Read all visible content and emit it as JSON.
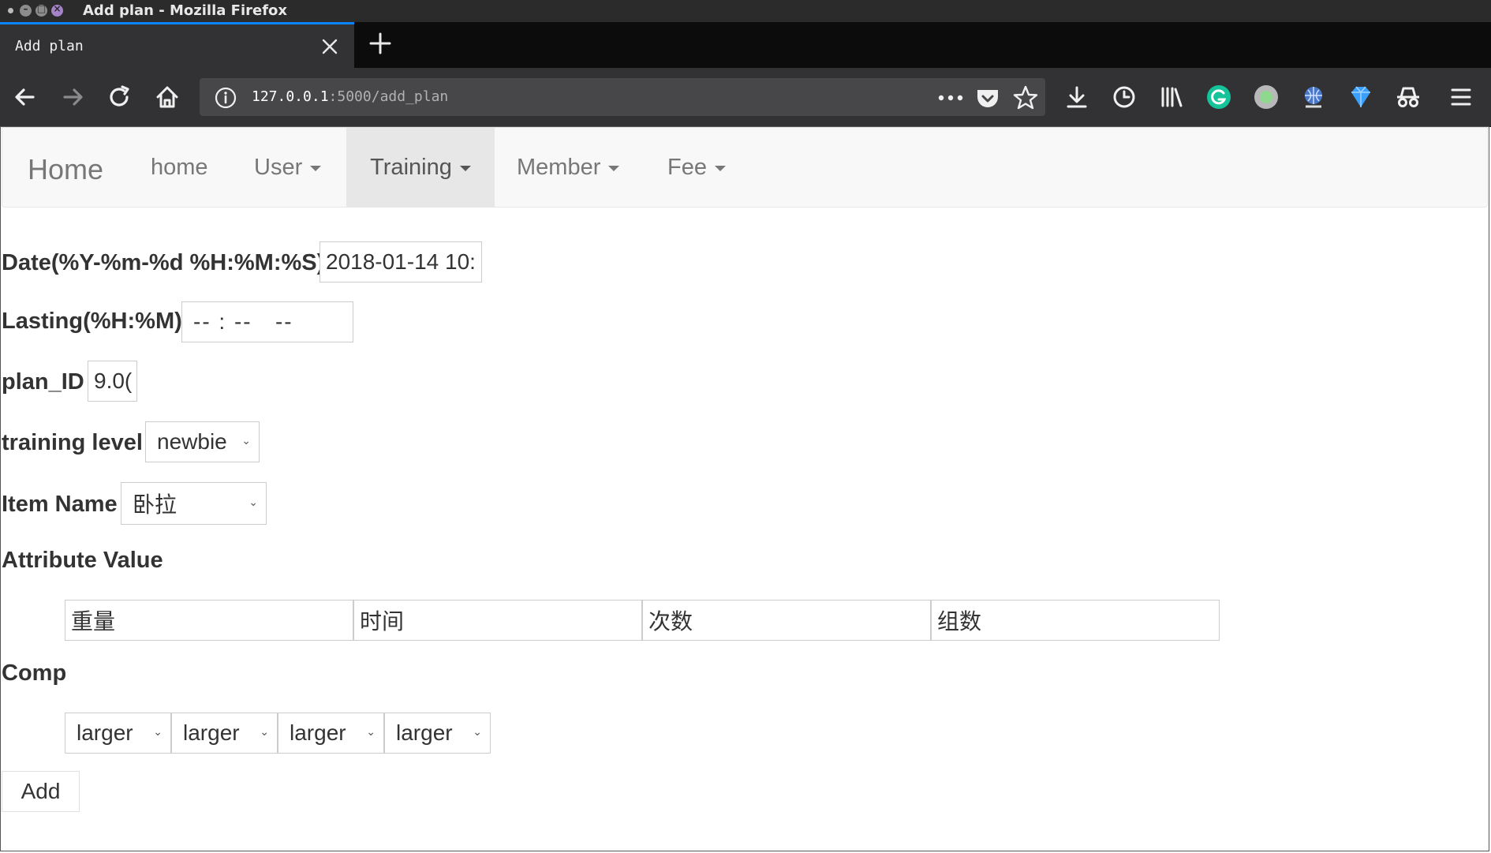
{
  "window": {
    "title": "Add plan - Mozilla Firefox"
  },
  "tab": {
    "label": "Add plan"
  },
  "url": {
    "host": "127.0.0.1",
    "path": ":5000/add_plan"
  },
  "nav": {
    "brand": "Home",
    "items": [
      {
        "label": "home",
        "dropdown": false
      },
      {
        "label": "User",
        "dropdown": true
      },
      {
        "label": "Training",
        "dropdown": true,
        "active": true
      },
      {
        "label": "Member",
        "dropdown": true
      },
      {
        "label": "Fee",
        "dropdown": true
      }
    ]
  },
  "form": {
    "date": {
      "label": "Date(%Y-%m-%d %H:%M:%S)",
      "value": "2018-01-14 10:"
    },
    "lasting": {
      "label": "Lasting(%H:%M)",
      "value": "-- : --   --"
    },
    "plan_id": {
      "label": "plan_ID",
      "value": "9.0("
    },
    "training_level": {
      "label": "training level",
      "value": "newbie"
    },
    "item_name": {
      "label": "Item Name",
      "value": "卧拉"
    },
    "attribute_value": {
      "label": "Attribute Value",
      "placeholders": [
        "重量",
        "时间",
        "次数",
        "组数"
      ]
    },
    "comp": {
      "label": "Comp",
      "values": [
        "larger",
        "larger",
        "larger",
        "larger"
      ]
    },
    "submit_label": "Add"
  },
  "colors": {
    "accent": "#0a84ff",
    "toolbar": "#323234",
    "navbar_bg": "#f8f8f8",
    "nav_active_bg": "#e7e7e7",
    "grammarly": "#15c39a"
  }
}
